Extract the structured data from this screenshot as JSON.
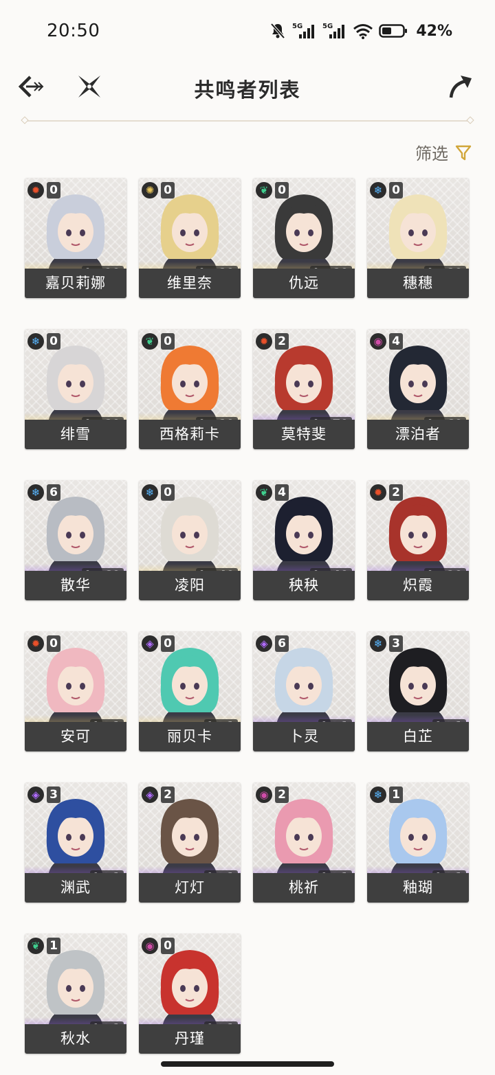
{
  "status_bar": {
    "time": "20:50",
    "battery": "42%"
  },
  "header": {
    "title": "共鸣者列表"
  },
  "filter": {
    "label": "筛选"
  },
  "colors": {
    "fusion": "#e8502a",
    "spectro": "#e6c45a",
    "aero": "#3fcf8e",
    "glacio": "#59b7ff",
    "electro": "#b06cff",
    "havoc": "#d04ca8",
    "five_star": "#eecf64",
    "four_star": "#9a5ee6"
  },
  "characters": [
    {
      "name": "嘉贝莉娜",
      "level": "Lv.90",
      "chain": "0",
      "element": "fusion",
      "rarity": 5,
      "hair": "#c9cedb"
    },
    {
      "name": "维里奈",
      "level": "Lv.80",
      "chain": "0",
      "element": "spectro",
      "rarity": 5,
      "hair": "#e6d08c"
    },
    {
      "name": "仇远",
      "level": "Lv.80",
      "chain": "0",
      "element": "aero",
      "rarity": 5,
      "hair": "#3a3a3a"
    },
    {
      "name": "穗穗",
      "level": "Lv.80",
      "chain": "0",
      "element": "glacio",
      "rarity": 5,
      "hair": "#efe2b8"
    },
    {
      "name": "绯雪",
      "level": "Lv.80",
      "chain": "0",
      "element": "glacio",
      "rarity": 5,
      "hair": "#d7d5d6"
    },
    {
      "name": "西格莉卡",
      "level": "Lv.80",
      "chain": "0",
      "element": "aero",
      "rarity": 5,
      "hair": "#ef7a33"
    },
    {
      "name": "莫特斐",
      "level": "Lv.70",
      "chain": "2",
      "element": "fusion",
      "rarity": 4,
      "hair": "#b83a2e"
    },
    {
      "name": "漂泊者",
      "level": "Lv.60",
      "chain": "4",
      "element": "havoc",
      "rarity": 5,
      "hair": "#232834"
    },
    {
      "name": "散华",
      "level": "Lv.60",
      "chain": "6",
      "element": "glacio",
      "rarity": 4,
      "hair": "#b8bcc3"
    },
    {
      "name": "凌阳",
      "level": "Lv.40",
      "chain": "0",
      "element": "glacio",
      "rarity": 5,
      "hair": "#dedbd4"
    },
    {
      "name": "秧秧",
      "level": "Lv.40",
      "chain": "4",
      "element": "aero",
      "rarity": 4,
      "hair": "#1d2030"
    },
    {
      "name": "炽霞",
      "level": "Lv.20",
      "chain": "2",
      "element": "fusion",
      "rarity": 4,
      "hair": "#a8332b"
    },
    {
      "name": "安可",
      "level": "Lv.1",
      "chain": "0",
      "element": "fusion",
      "rarity": 5,
      "hair": "#f0b8c0"
    },
    {
      "name": "丽贝卡",
      "level": "Lv.1",
      "chain": "0",
      "element": "electro",
      "rarity": 5,
      "hair": "#4fc9b1"
    },
    {
      "name": "卜灵",
      "level": "Lv.1",
      "chain": "6",
      "element": "electro",
      "rarity": 4,
      "hair": "#c6d6e6"
    },
    {
      "name": "白芷",
      "level": "Lv.1",
      "chain": "3",
      "element": "glacio",
      "rarity": 4,
      "hair": "#1e1e22"
    },
    {
      "name": "渊武",
      "level": "Lv.1",
      "chain": "3",
      "element": "electro",
      "rarity": 4,
      "hair": "#2e4fa0"
    },
    {
      "name": "灯灯",
      "level": "Lv.1",
      "chain": "2",
      "element": "electro",
      "rarity": 4,
      "hair": "#6a5446"
    },
    {
      "name": "桃祈",
      "level": "Lv.1",
      "chain": "2",
      "element": "havoc",
      "rarity": 4,
      "hair": "#ea9ab0"
    },
    {
      "name": "釉瑚",
      "level": "Lv.1",
      "chain": "1",
      "element": "glacio",
      "rarity": 4,
      "hair": "#a9c8ee"
    },
    {
      "name": "秋水",
      "level": "Lv.1",
      "chain": "1",
      "element": "aero",
      "rarity": 4,
      "hair": "#bfc3c6"
    },
    {
      "name": "丹瑾",
      "level": "Lv.1",
      "chain": "0",
      "element": "havoc",
      "rarity": 4,
      "hair": "#c8332e"
    }
  ]
}
